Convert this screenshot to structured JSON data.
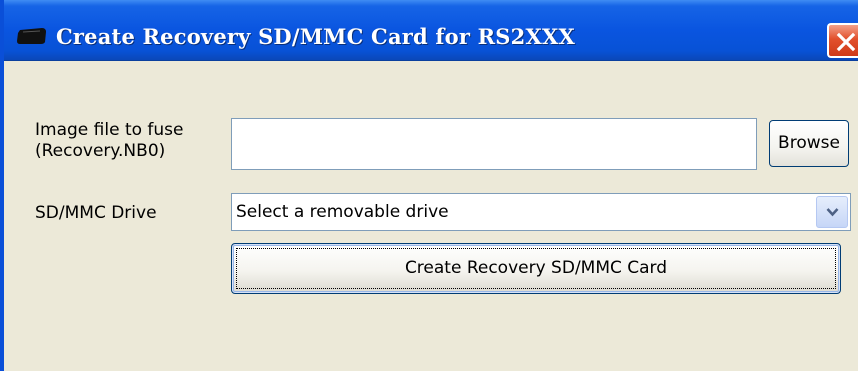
{
  "window": {
    "title": "Create Recovery SD/MMC Card for RS2XXX",
    "app_icon": "sd-card-icon",
    "close_icon": "close-icon"
  },
  "form": {
    "image_label_line1": "Image file to fuse",
    "image_label_line2": "(Recovery.NB0)",
    "image_value": "",
    "browse_label": "Browse",
    "drive_label": "SD/MMC Drive",
    "drive_selected": "Select a removable drive",
    "create_label": "Create Recovery SD/MMC Card"
  },
  "colors": {
    "titlebar": "#0a55e0",
    "window_bg": "#ece9d8",
    "close_button": "#e2502c",
    "field_border": "#7f9db9"
  }
}
